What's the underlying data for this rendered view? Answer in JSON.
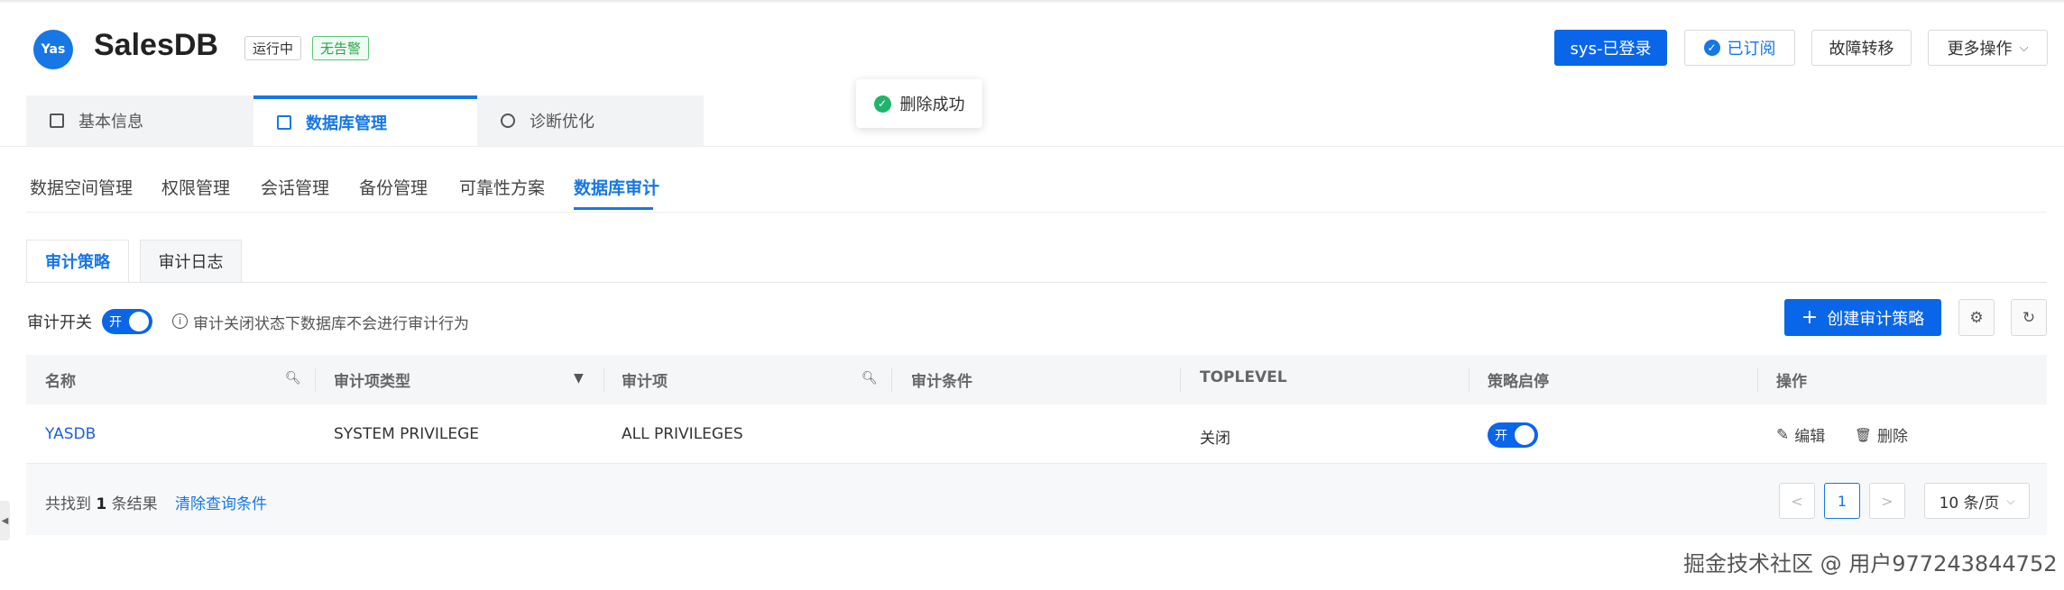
{
  "header": {
    "logo_text": "Yas",
    "title": "SalesDB",
    "status_badge": "运行中",
    "alarm_badge": "无告警",
    "buttons": {
      "login": "sys-已登录",
      "subscribed": "已订阅",
      "failover": "故障转移",
      "more": "更多操作"
    }
  },
  "toast": {
    "message": "删除成功"
  },
  "main_tabs": [
    {
      "label": "基本信息",
      "active": false
    },
    {
      "label": "数据库管理",
      "active": true
    },
    {
      "label": "诊断优化",
      "active": false
    }
  ],
  "subnav": [
    {
      "label": "数据空间管理"
    },
    {
      "label": "权限管理"
    },
    {
      "label": "会话管理"
    },
    {
      "label": "备份管理"
    },
    {
      "label": "可靠性方案"
    },
    {
      "label": "数据库审计",
      "active": true
    }
  ],
  "inner_tabs": [
    {
      "label": "审计策略",
      "active": true
    },
    {
      "label": "审计日志"
    }
  ],
  "audit_switch": {
    "label": "审计开关",
    "state": "开",
    "info": "审计关闭状态下数据库不会进行审计行为"
  },
  "toolbar": {
    "create_label": "创建审计策略"
  },
  "table": {
    "columns": [
      "名称",
      "审计项类型",
      "审计项",
      "审计条件",
      "TOPLEVEL",
      "策略启停",
      "操作"
    ],
    "rows": [
      {
        "name": "YASDB",
        "type": "SYSTEM PRIVILEGE",
        "item": "ALL PRIVILEGES",
        "condition": "",
        "toplevel": "关闭",
        "enabled_label": "开",
        "edit": "编辑",
        "delete": "删除"
      }
    ]
  },
  "footer": {
    "found_prefix": "共找到",
    "found_count": "1",
    "found_suffix": "条结果",
    "clear_label": "清除查询条件",
    "current_page": "1",
    "page_size": "10 条/页"
  },
  "watermark": "掘金技术社区 @ 用户977243844752",
  "colors": {
    "primary": "#0a66e8",
    "link": "#1677e5",
    "success": "#22b36b"
  }
}
